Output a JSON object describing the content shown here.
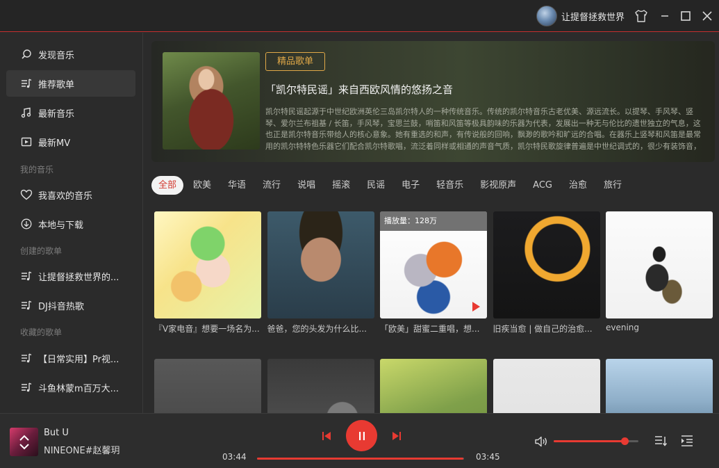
{
  "titlebar": {
    "username": "让提督拯救世界"
  },
  "sidebar": {
    "items": [
      {
        "label": "发现音乐",
        "icon": "search-icon"
      },
      {
        "label": "推荐歌单",
        "icon": "playlist-icon"
      },
      {
        "label": "最新音乐",
        "icon": "music-note-icon"
      },
      {
        "label": "最新MV",
        "icon": "video-icon"
      }
    ],
    "my_music_title": "我的音乐",
    "my_music": [
      {
        "label": "我喜欢的音乐",
        "icon": "heart-icon"
      },
      {
        "label": "本地与下载",
        "icon": "download-icon"
      }
    ],
    "created_title": "创建的歌单",
    "created": [
      {
        "label": "让提督拯救世界的...",
        "icon": "playlist-icon"
      },
      {
        "label": "DJ抖音热歌",
        "icon": "playlist-icon"
      }
    ],
    "collected_title": "收藏的歌单",
    "collected": [
      {
        "label": "【日常实用】Pr视...",
        "icon": "playlist-icon"
      },
      {
        "label": "斗鱼林蒙m百万大...",
        "icon": "playlist-icon"
      }
    ]
  },
  "banner": {
    "tag": "精品歌单",
    "title": "「凯尔特民谣」来自西欧风情的悠扬之音",
    "description": "凯尔特民谣起源于中世纪欧洲英伦三岛凯尔特人的一种传统音乐。传统的凯尔特音乐古老优美、源远流长。以提琴、手风琴、竖琴、爱尔兰布祖基 / 长笛，手风琴，宝思兰鼓，哨笛和风笛等极具韵味的乐器为代表，发展出一种无与伦比的遗世独立的气息，这也正是凯尔特音乐带给人的核心意象。她有重选的和声，有传说般的回响，飘渺的歌吟和旷远的合唱。在器乐上竖琴和风笛是最常用的凯尔特特色乐器它们配合凯尔特歌唱，流泛着同样或相通的声音气质，凯尔特民歌旋律普遍是中世纪调式的，很少有装饰音，也较少跨跳式的行进;平缓地发展，简单地回旋，旋律有一种虚幻感和消逝"
  },
  "categories": [
    "全部",
    "欧美",
    "华语",
    "流行",
    "说唱",
    "摇滚",
    "民谣",
    "电子",
    "轻音乐",
    "影视原声",
    "ACG",
    "治愈",
    "旅行"
  ],
  "active_category": 0,
  "playlists": [
    {
      "name": "『V家电音』想要一场名为...",
      "plays": ""
    },
    {
      "name": "爸爸，您的头发为什么比...",
      "plays": ""
    },
    {
      "name": "「欧美」甜蜜二重唱，想...",
      "plays": "播放量：128万"
    },
    {
      "name": "旧疾当愈 | 做自己的治愈...",
      "plays": ""
    },
    {
      "name": "evening",
      "plays": ""
    },
    {
      "name": "",
      "plays": ""
    },
    {
      "name": "",
      "plays": ""
    },
    {
      "name": "",
      "plays": ""
    },
    {
      "name": "",
      "plays": ""
    },
    {
      "name": "",
      "plays": ""
    }
  ],
  "player": {
    "song": "But U",
    "artist": "NINEONE#赵馨玥",
    "current_time": "03:44",
    "total_time": "03:45",
    "progress": 0.995,
    "volume": 0.84
  },
  "colors": {
    "accent": "#e83a32",
    "tag": "#e1a948"
  }
}
